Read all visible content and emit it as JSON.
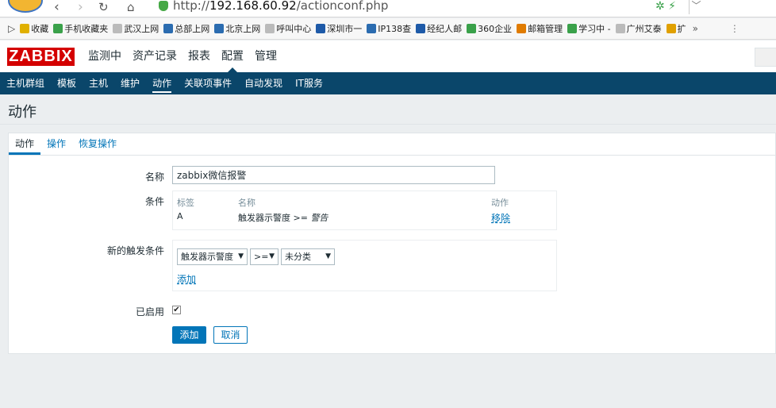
{
  "browser": {
    "url_scheme": "http://",
    "url_host": "192.168.60.92",
    "url_path": "/actionconf.php"
  },
  "bookmarks": [
    {
      "label": "收藏",
      "icon": "star-icon",
      "color": "#e0b000"
    },
    {
      "label": "手机收藏夹",
      "icon": "phone-icon",
      "color": "#3aa14a"
    },
    {
      "label": "武汉上网",
      "icon": "page-icon",
      "color": "#bbbbbb"
    },
    {
      "label": "总部上网",
      "icon": "globe-icon",
      "color": "#2b6cb0"
    },
    {
      "label": "北京上网",
      "icon": "globe-icon",
      "color": "#2b6cb0"
    },
    {
      "label": "呼叫中心",
      "icon": "page-icon",
      "color": "#bbbbbb"
    },
    {
      "label": "深圳市一",
      "icon": "mail-icon",
      "color": "#1e5aa8"
    },
    {
      "label": "IP138查",
      "icon": "ip-icon",
      "color": "#2b6cb0"
    },
    {
      "label": "经纪人邮",
      "icon": "mail-icon",
      "color": "#1e5aa8"
    },
    {
      "label": "360企业",
      "icon": "360-icon",
      "color": "#3aa14a"
    },
    {
      "label": "邮箱管理",
      "icon": "mailbox-icon",
      "color": "#e07b00"
    },
    {
      "label": "学习中 -",
      "icon": "shield-icon",
      "color": "#3aa14a"
    },
    {
      "label": "广州艾泰",
      "icon": "page-icon",
      "color": "#bbbbbb"
    },
    {
      "label": "扩",
      "icon": "extension-icon",
      "color": "#e0a000"
    }
  ],
  "header": {
    "logo": "ZABBIX",
    "menu": [
      "监测中",
      "资产记录",
      "报表",
      "配置",
      "管理"
    ],
    "active_menu_index": 3
  },
  "submenu": {
    "items": [
      "主机群组",
      "模板",
      "主机",
      "维护",
      "动作",
      "关联项事件",
      "自动发现",
      "IT服务"
    ],
    "active_index": 4
  },
  "page": {
    "title": "动作"
  },
  "tabs": {
    "items": [
      "动作",
      "操作",
      "恢复操作"
    ],
    "active_index": 0
  },
  "form": {
    "name_label": "名称",
    "name_value": "zabbix微信报警",
    "conditions_label": "条件",
    "conditions_headers": {
      "label": "标签",
      "name": "名称",
      "action": "动作"
    },
    "conditions_rows": [
      {
        "label": "A",
        "name_prefix": "触发器示警度 >= ",
        "name_value": "警告",
        "action": "移除"
      }
    ],
    "new_condition_label": "新的触发条件",
    "new_condition_selects": [
      "触发器示警度",
      ">=",
      "未分类"
    ],
    "add_link": "添加",
    "enabled_label": "已启用",
    "enabled": true,
    "submit_label": "添加",
    "cancel_label": "取消"
  },
  "colors": {
    "brand": "#d40000",
    "nav_bg": "#0a466a",
    "link": "#0275b8"
  }
}
